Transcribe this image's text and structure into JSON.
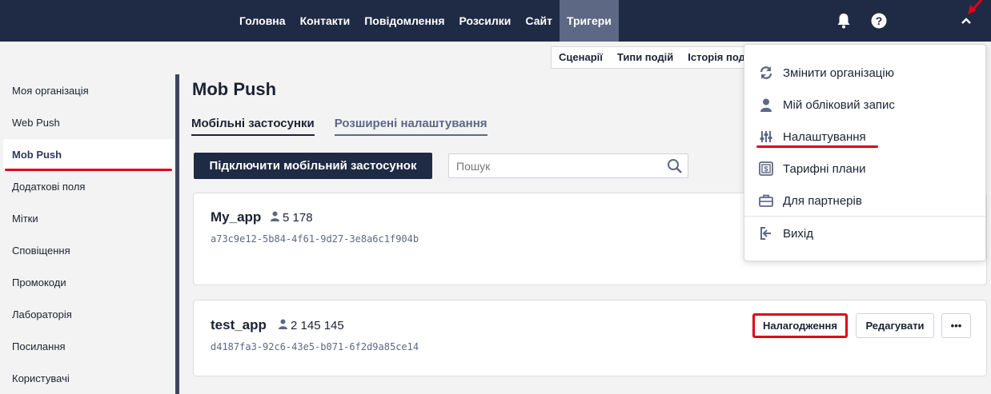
{
  "topnav": {
    "items": [
      {
        "label": "Головна"
      },
      {
        "label": "Контакти"
      },
      {
        "label": "Повідомлення"
      },
      {
        "label": "Розсилки"
      },
      {
        "label": "Сайт"
      },
      {
        "label": "Тригери"
      }
    ],
    "active_index": 5,
    "icons": [
      "bell-icon",
      "help-icon",
      "chevron-up-icon"
    ]
  },
  "subnav": {
    "items": [
      {
        "label": "Сценарії"
      },
      {
        "label": "Типи подій"
      },
      {
        "label": "Історія поді"
      }
    ]
  },
  "sidebar": {
    "items": [
      {
        "label": "Моя організація"
      },
      {
        "label": "Web Push"
      },
      {
        "label": "Mob Push"
      },
      {
        "label": "Додаткові поля"
      },
      {
        "label": "Мітки"
      },
      {
        "label": "Сповіщення"
      },
      {
        "label": "Промокоди"
      },
      {
        "label": "Лабораторія"
      },
      {
        "label": "Посилання"
      },
      {
        "label": "Користувачі"
      }
    ],
    "active_index": 2
  },
  "main": {
    "title": "Mob Push",
    "tabs": [
      {
        "label": "Мобільні застосунки"
      },
      {
        "label": "Розширені налаштування"
      }
    ],
    "connect_button": "Підключити мобільний застосунок",
    "search": {
      "placeholder": "Пошук",
      "value": ""
    },
    "apps": [
      {
        "name": "My_app",
        "users": "5 178",
        "id": "a73c9e12-5b84-4f61-9d27-3e8a6c1f904b"
      },
      {
        "name": "test_app",
        "users": "2 145 145",
        "id": "d4187fa3-92c6-43e5-b071-6f2d9a85ce14",
        "buttons": {
          "debug": "Налагодження",
          "edit": "Редагувати",
          "more": "•••"
        }
      }
    ]
  },
  "dropdown": {
    "items": [
      {
        "label": "Змінити організацію",
        "icon": "refresh-icon"
      },
      {
        "label": "Мій обліковий запис",
        "icon": "user-icon"
      },
      {
        "label": "Налаштування",
        "icon": "sliders-icon"
      },
      {
        "label": "Тарифні плани",
        "icon": "money-icon"
      },
      {
        "label": "Для партнерів",
        "icon": "briefcase-icon"
      },
      {
        "label": "Вихід",
        "icon": "logout-icon"
      }
    ]
  },
  "colors": {
    "nav_bg": "#1f2a44",
    "nav_active": "#5d6884",
    "annotation_red": "#e0001a"
  }
}
